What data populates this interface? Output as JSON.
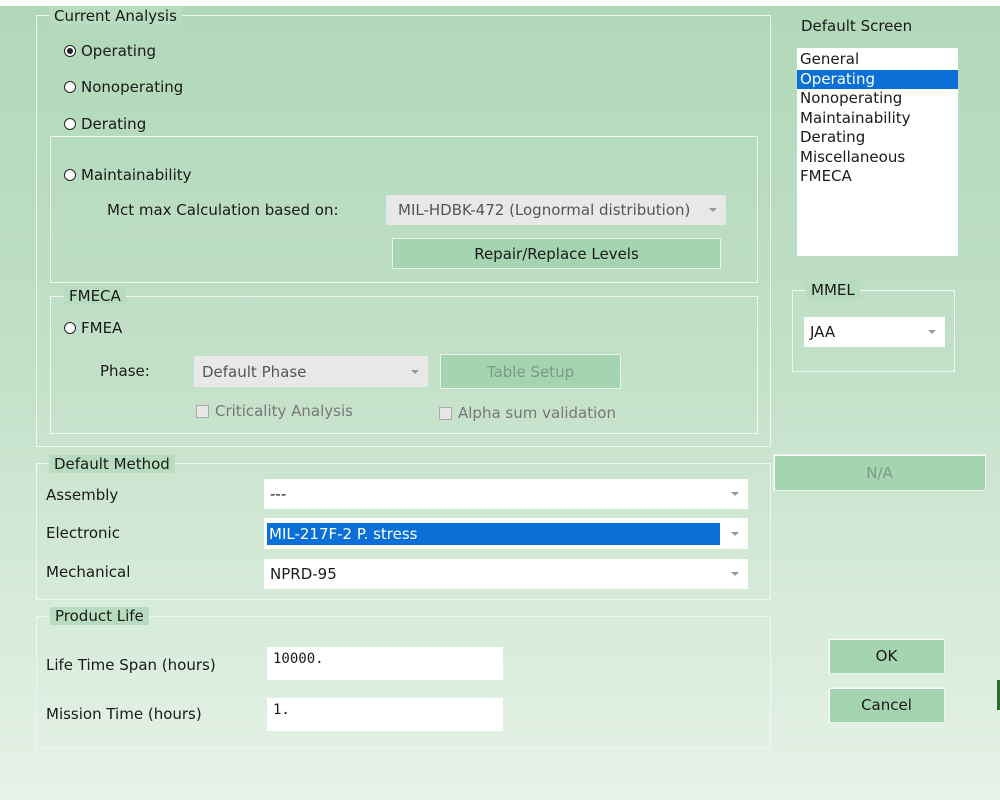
{
  "current_analysis": {
    "title": "Current Analysis",
    "options": {
      "operating": "Operating",
      "nonoperating": "Nonoperating",
      "derating": "Derating",
      "maintainability": "Maintainability"
    },
    "selected": "Operating",
    "mct_label": "Mct max Calculation based on:",
    "mct_value": "MIL-HDBK-472 (Lognormal distribution)",
    "repair_button": "Repair/Replace Levels"
  },
  "fmeca": {
    "title": "FMECA",
    "fmea_label": "FMEA",
    "phase_label": "Phase:",
    "phase_value": "Default Phase",
    "table_setup": "Table Setup",
    "criticality": "Criticality Analysis",
    "alpha_sum": "Alpha sum validation"
  },
  "default_screen": {
    "title": "Default Screen",
    "items": [
      "General",
      "Operating",
      "Nonoperating",
      "Maintainability",
      "Derating",
      "Miscellaneous",
      "FMECA"
    ],
    "selected_index": 1
  },
  "mmel": {
    "title": "MMEL",
    "value": "JAA"
  },
  "na_button": "N/A",
  "default_method": {
    "title": "Default Method",
    "assembly_label": "Assembly",
    "assembly_value": "---",
    "electronic_label": "Electronic",
    "electronic_value": "MIL-217F-2 P. stress",
    "mechanical_label": "Mechanical",
    "mechanical_value": "NPRD-95"
  },
  "product_life": {
    "title": "Product Life",
    "life_label": "Life Time Span (hours)",
    "life_value": "10000.",
    "mission_label": "Mission Time (hours)",
    "mission_value": "1."
  },
  "buttons": {
    "ok": "OK",
    "cancel": "Cancel"
  }
}
